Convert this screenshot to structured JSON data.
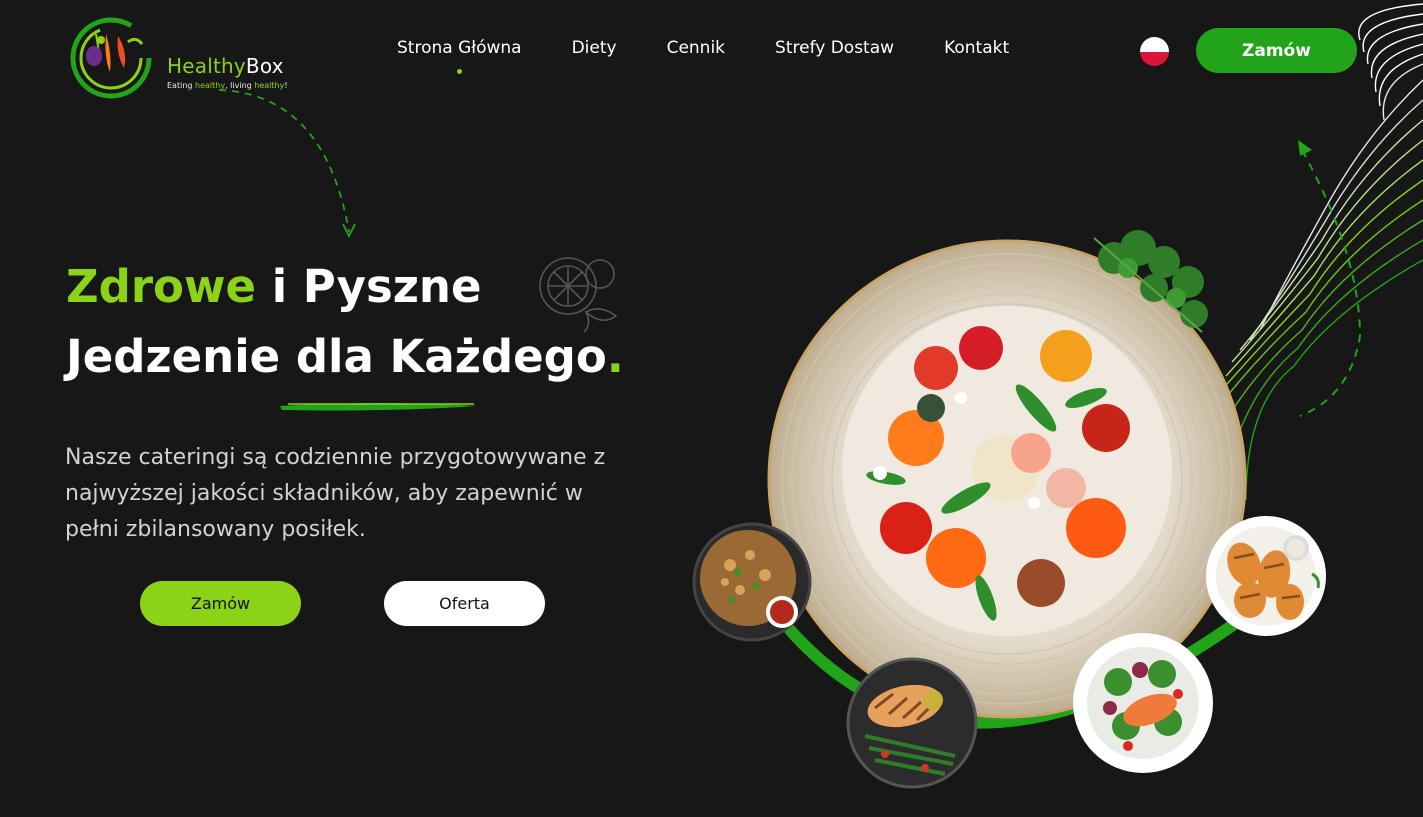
{
  "brand": {
    "name_part1": "Healthy",
    "name_part2": "Box",
    "tagline_1": "Eating ",
    "tagline_2": "healthy",
    "tagline_3": ", living ",
    "tagline_4": "healthy",
    "tagline_5": "!"
  },
  "nav": {
    "items": [
      {
        "label": "Strona Główna",
        "active": true
      },
      {
        "label": "Diety"
      },
      {
        "label": "Cennik"
      },
      {
        "label": "Strefy Dostaw"
      },
      {
        "label": "Kontakt"
      }
    ]
  },
  "header": {
    "language_flag": "flag-pl-icon",
    "order_label": "Zamów"
  },
  "hero": {
    "title_green": "Zdrowe",
    "title_rest": " i Pyszne",
    "title_line2": "Jedzenie dla Każdego",
    "title_dot": ".",
    "description": "Nasze cateringi są codziennie przygotowywane z najwyższej jakości składników, aby zapewnić w pełni zbilansowany posiłek.",
    "order_label": "Zamów",
    "offer_label": "Oferta"
  },
  "colors": {
    "background": "#171717",
    "accent_lime": "#8cd317",
    "accent_green": "#21a41a",
    "text": "#ffffff"
  }
}
